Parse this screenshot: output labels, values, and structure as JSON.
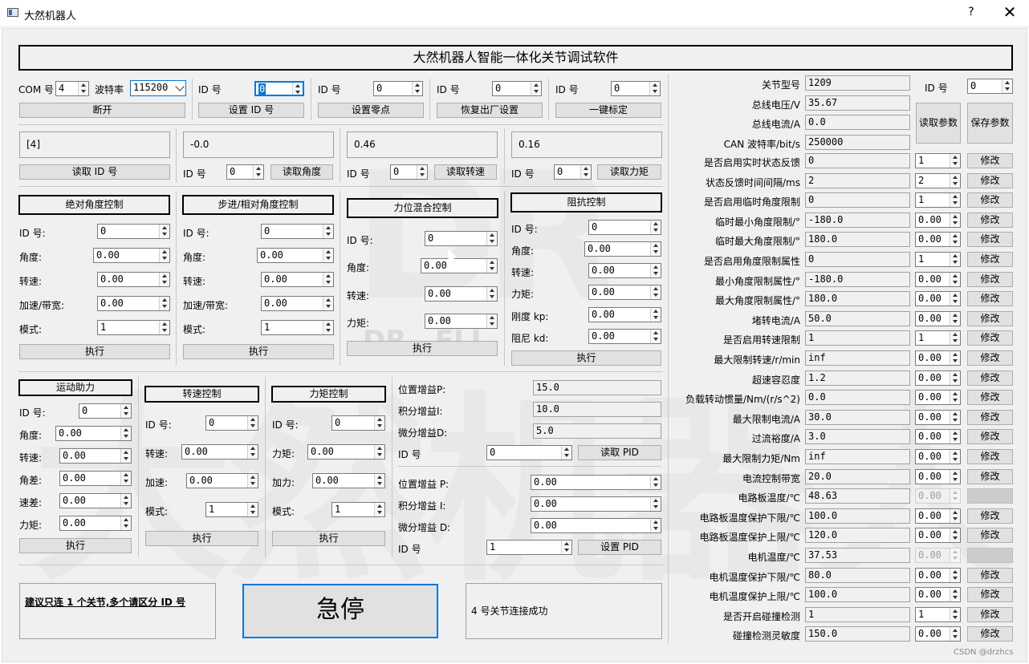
{
  "window": {
    "title": "大然机器人",
    "help": "?",
    "close": "✕"
  },
  "banner": "大然机器人智能一体化关节调试软件",
  "watermark": {
    "logo": "DR",
    "big": "大然机器人",
    "small": "DR   ELI"
  },
  "conn": {
    "com_label": "COM 号",
    "com_value": "4",
    "baud_label": "波特率",
    "baud_value": "115200",
    "disconnect": "断开"
  },
  "setid": {
    "id_label": "ID 号",
    "id_value": "0",
    "btn": "设置 ID 号"
  },
  "zero": {
    "id_label": "ID 号",
    "id_value": "0",
    "btn": "设置零点"
  },
  "factory": {
    "id_label": "ID 号",
    "id_value": "0",
    "btn": "恢复出厂设置"
  },
  "calib": {
    "id_label": "ID 号",
    "id_value": "0",
    "btn": "一键标定"
  },
  "readid": {
    "display": "[4]",
    "btn": "读取 ID 号"
  },
  "readangle": {
    "display": "-0.0",
    "id_label": "ID 号",
    "id_value": "0",
    "btn": "读取角度"
  },
  "readspeed": {
    "display": "0.46",
    "id_label": "ID 号",
    "id_value": "0",
    "btn": "读取转速"
  },
  "readtorque": {
    "display": "0.16",
    "id_label": "ID 号",
    "id_value": "0",
    "btn": "读取力矩"
  },
  "abs_angle": {
    "title": "绝对角度控制",
    "id_label": "ID 号:",
    "id_value": "0",
    "angle_label": "角度:",
    "angle_value": "0.00",
    "speed_label": "转速:",
    "speed_value": "0.00",
    "acc_label": "加速/带宽:",
    "acc_value": "0.00",
    "mode_label": "模式:",
    "mode_value": "1",
    "exec": "执行"
  },
  "step_angle": {
    "title": "步进/相对角度控制",
    "id_label": "ID 号:",
    "id_value": "0",
    "angle_label": "角度:",
    "angle_value": "0.00",
    "speed_label": "转速:",
    "speed_value": "0.00",
    "acc_label": "加速/带宽:",
    "acc_value": "0.00",
    "mode_label": "模式:",
    "mode_value": "1",
    "exec": "执行"
  },
  "hybrid": {
    "title": "力位混合控制",
    "id_label": "ID 号:",
    "id_value": "0",
    "angle_label": "角度:",
    "angle_value": "0.00",
    "speed_label": "转速:",
    "speed_value": "0.00",
    "torque_label": "力矩:",
    "torque_value": "0.00",
    "exec": "执行"
  },
  "impedance": {
    "title": "阻抗控制",
    "id_label": "ID 号:",
    "id_value": "0",
    "angle_label": "角度:",
    "angle_value": "0.00",
    "speed_label": "转速:",
    "speed_value": "0.00",
    "torque_label": "力矩:",
    "torque_value": "0.00",
    "kp_label": "刚度 kp:",
    "kp_value": "0.00",
    "kd_label": "阻尼 kd:",
    "kd_value": "0.00",
    "exec": "执行"
  },
  "assist": {
    "title": "运动助力",
    "id_label": "ID 号:",
    "id_value": "0",
    "angle_label": "角度:",
    "angle_value": "0.00",
    "speed_label": "转速:",
    "speed_value": "0.00",
    "adiff_label": "角差:",
    "adiff_value": "0.00",
    "sdiff_label": "速差:",
    "sdiff_value": "0.00",
    "torque_label": "力矩:",
    "torque_value": "0.00",
    "exec": "执行"
  },
  "speedctl": {
    "title": "转速控制",
    "id_label": "ID 号:",
    "id_value": "0",
    "speed_label": "转速:",
    "speed_value": "0.00",
    "acc_label": "加速:",
    "acc_value": "0.00",
    "mode_label": "模式:",
    "mode_value": "1",
    "exec": "执行"
  },
  "torquectl": {
    "title": "力矩控制",
    "id_label": "ID 号:",
    "id_value": "0",
    "torque_label": "力矩:",
    "torque_value": "0.00",
    "acc_label": "加力:",
    "acc_value": "0.00",
    "mode_label": "模式:",
    "mode_value": "1",
    "exec": "执行"
  },
  "pid_read": {
    "p_label": "位置增益P:",
    "p_value": "15.0",
    "i_label": "积分增益I:",
    "i_value": "10.0",
    "d_label": "微分增益D:",
    "d_value": "5.0",
    "id_label": "ID 号",
    "id_value": "0",
    "btn": "读取 PID"
  },
  "pid_set": {
    "p_label": "位置增益 P:",
    "p_value": "0.00",
    "i_label": "积分增益 I:",
    "i_value": "0.00",
    "d_label": "微分增益 D:",
    "d_value": "0.00",
    "id_label": "ID 号",
    "id_value": "1",
    "btn": "设置 PID"
  },
  "note": "建议只连 1 个关节,多个请区分 ID 号",
  "estop": "急停",
  "status": "4 号关节连接成功",
  "params": {
    "id_label": "ID 号",
    "id_value": "0",
    "read_btn": "读取参数",
    "save_btn": "保存参数",
    "info": [
      {
        "label": "关节型号",
        "value": "1209"
      },
      {
        "label": "总线电压/V",
        "value": "35.67"
      },
      {
        "label": "总线电流/A",
        "value": "0.0"
      },
      {
        "label": "CAN 波特率/bit/s",
        "value": "250000"
      }
    ],
    "rows": [
      {
        "label": "是否启用实时状态反馈",
        "value": "0",
        "spin": "1",
        "btn": "修改"
      },
      {
        "label": "状态反馈时间间隔/ms",
        "value": "2",
        "spin": "2",
        "btn": "修改"
      },
      {
        "label": "是否启用临时角度限制",
        "value": "0",
        "spin": "1",
        "btn": "修改"
      },
      {
        "label": "临时最小角度限制/°",
        "value": "-180.0",
        "spin": "0.00",
        "btn": "修改"
      },
      {
        "label": "临时最大角度限制/°",
        "value": "180.0",
        "spin": "0.00",
        "btn": "修改"
      },
      {
        "label": "是否启用角度限制属性",
        "value": "0",
        "spin": "1",
        "btn": "修改"
      },
      {
        "label": "最小角度限制属性/°",
        "value": "-180.0",
        "spin": "0.00",
        "btn": "修改"
      },
      {
        "label": "最大角度限制属性/°",
        "value": "180.0",
        "spin": "0.00",
        "btn": "修改"
      },
      {
        "label": "堵转电流/A",
        "value": "50.0",
        "spin": "0.00",
        "btn": "修改"
      },
      {
        "label": "是否启用转速限制",
        "value": "1",
        "spin": "1",
        "btn": "修改"
      },
      {
        "label": "最大限制转速/r/min",
        "value": "inf",
        "spin": "0.00",
        "btn": "修改"
      },
      {
        "label": "超速容忍度",
        "value": "1.2",
        "spin": "0.00",
        "btn": "修改"
      },
      {
        "label": "负载转动惯量/Nm/(r/s^2)",
        "value": "0.0",
        "spin": "0.00",
        "btn": "修改"
      },
      {
        "label": "最大限制电流/A",
        "value": "30.0",
        "spin": "0.00",
        "btn": "修改"
      },
      {
        "label": "过流裕度/A",
        "value": "3.0",
        "spin": "0.00",
        "btn": "修改"
      },
      {
        "label": "最大限制力矩/Nm",
        "value": "inf",
        "spin": "0.00",
        "btn": "修改"
      },
      {
        "label": "电流控制带宽",
        "value": "20.0",
        "spin": "0.00",
        "btn": "修改"
      },
      {
        "label": "电路板温度/℃",
        "value": "48.63",
        "spin": "0.00",
        "btn": "",
        "disabled": true
      },
      {
        "label": "电路板温度保护下限/℃",
        "value": "100.0",
        "spin": "0.00",
        "btn": "修改"
      },
      {
        "label": "电路板温度保护上限/℃",
        "value": "120.0",
        "spin": "0.00",
        "btn": "修改"
      },
      {
        "label": "电机温度/℃",
        "value": "37.53",
        "spin": "0.00",
        "btn": "",
        "disabled": true
      },
      {
        "label": "电机温度保护下限/℃",
        "value": "80.0",
        "spin": "0.00",
        "btn": "修改"
      },
      {
        "label": "电机温度保护上限/℃",
        "value": "100.0",
        "spin": "0.00",
        "btn": "修改"
      },
      {
        "label": "是否开启碰撞检测",
        "value": "1",
        "spin": "1",
        "btn": "修改"
      },
      {
        "label": "碰撞检测灵敏度",
        "value": "150.0",
        "spin": "0.00",
        "btn": "修改"
      }
    ]
  },
  "footer": "CSDN @drzhcs"
}
